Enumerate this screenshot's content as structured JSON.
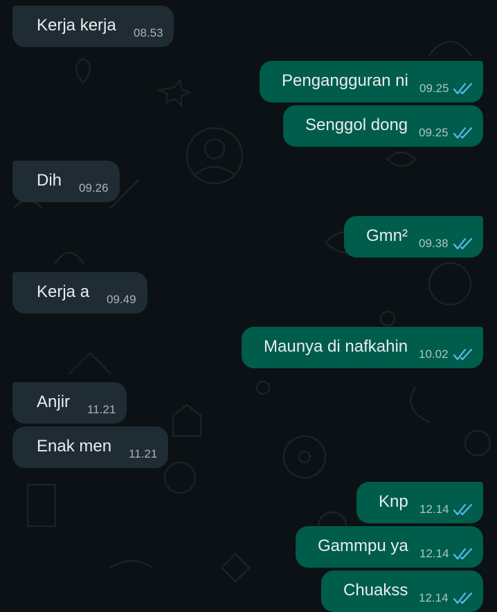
{
  "colors": {
    "background": "#0b1114",
    "incoming_bubble": "#1f2c33",
    "outgoing_bubble": "#005c4b",
    "read_tick": "#53bdeb"
  },
  "messages": [
    {
      "direction": "incoming",
      "text": "Kerja kerja",
      "time": "08.53"
    },
    {
      "direction": "outgoing",
      "text": "Pengangguran ni",
      "time": "09.25",
      "status_icon": "double-check-read-icon"
    },
    {
      "direction": "outgoing",
      "text": "Senggol dong",
      "time": "09.25",
      "status_icon": "double-check-read-icon"
    },
    {
      "direction": "incoming",
      "text": "Dih",
      "time": "09.26"
    },
    {
      "direction": "outgoing",
      "text": "Gmn²",
      "time": "09.38",
      "status_icon": "double-check-read-icon"
    },
    {
      "direction": "incoming",
      "text": "Kerja a",
      "time": "09.49"
    },
    {
      "direction": "outgoing",
      "text": "Maunya di nafkahin",
      "time": "10.02",
      "status_icon": "double-check-read-icon"
    },
    {
      "direction": "incoming",
      "text": "Anjir",
      "time": "11.21"
    },
    {
      "direction": "incoming",
      "text": "Enak men",
      "time": "11.21"
    },
    {
      "direction": "outgoing",
      "text": "Knp",
      "time": "12.14",
      "status_icon": "double-check-read-icon"
    },
    {
      "direction": "outgoing",
      "text": "Gammpu ya",
      "time": "12.14",
      "status_icon": "double-check-read-icon"
    },
    {
      "direction": "outgoing",
      "text": "Chuakss",
      "time": "12.14",
      "status_icon": "double-check-read-icon"
    }
  ]
}
